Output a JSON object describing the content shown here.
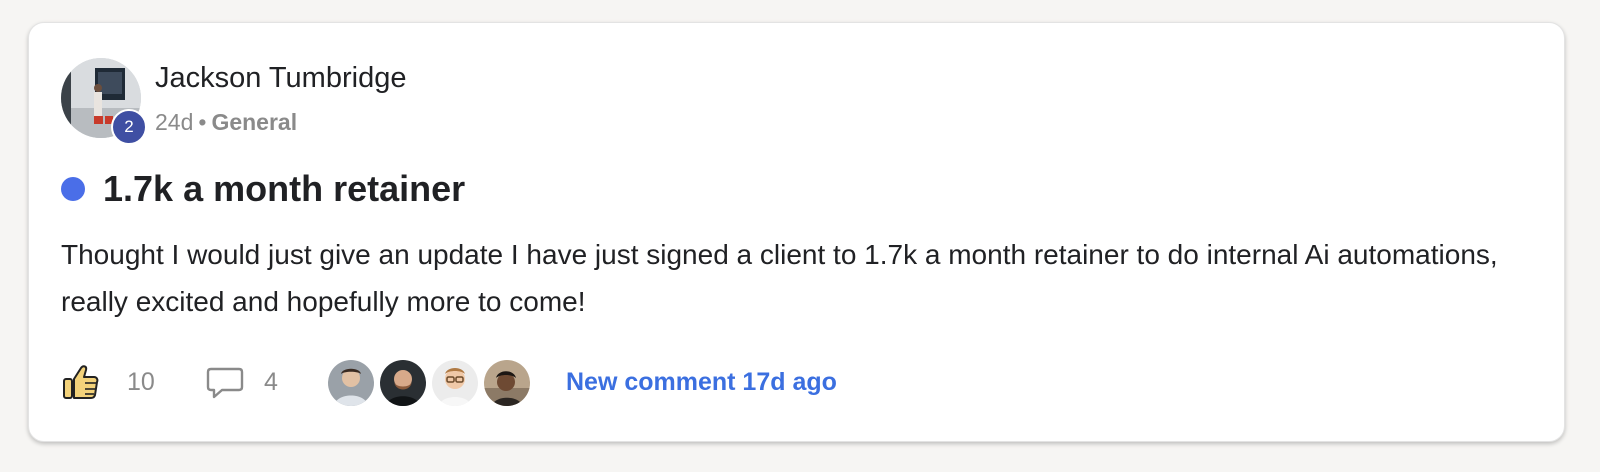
{
  "post": {
    "author": "Jackson Tumbridge",
    "level": "2",
    "time_ago": "24d",
    "separator": "•",
    "category": "General",
    "title": "1.7k a month retainer",
    "body": "Thought I would just give an update I have just signed a client to 1.7k a month retainer to do internal Ai automations, really excited and hopefully more to come!"
  },
  "footer": {
    "like_count": "10",
    "comment_count": "4",
    "new_comment_label": "New comment 17d ago",
    "commenter_avatars": [
      "avatar-1",
      "avatar-2",
      "avatar-3",
      "avatar-4"
    ]
  },
  "colors": {
    "unread_dot": "#4a6ee8",
    "link": "#3b6fe0",
    "level_badge": "#3f4fa3"
  }
}
